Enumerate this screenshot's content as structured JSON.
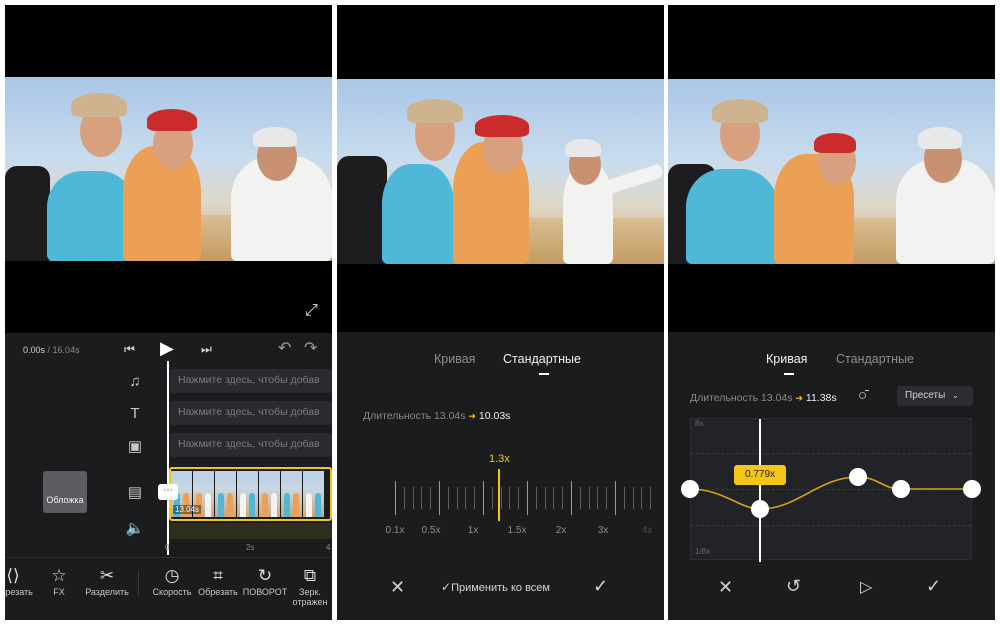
{
  "panel1": {
    "time_current": "0.00s",
    "time_sep": " / ",
    "time_total": "16.04s",
    "track_hint_audio": "Нажмите здесь, чтобы добав",
    "track_hint_text": "Нажмите здесь, чтобы добав",
    "track_hint_sticker": "Нажмите здесь, чтобы добав",
    "cover_label": "Обложка",
    "clip_duration": "13.04s",
    "ruler_marks": [
      "0",
      "2s",
      "4"
    ],
    "tools": [
      {
        "icon": "code-brackets-icon",
        "glyph": "⟨⟩",
        "label": "Обрезать"
      },
      {
        "icon": "star-icon",
        "glyph": "☆",
        "label": "FX"
      },
      {
        "icon": "scissors-icon",
        "glyph": "✂",
        "label": "Разделить"
      },
      {
        "icon": "speed-gauge-icon",
        "glyph": "◷",
        "label": "Скорость"
      },
      {
        "icon": "crop-icon",
        "glyph": "⌗",
        "label": "Обрезать"
      },
      {
        "icon": "rotate-icon",
        "glyph": "↻",
        "label": "ПОВОРОТ"
      },
      {
        "icon": "mirror-icon",
        "glyph": "⧉",
        "label": "Зерк. отражен"
      }
    ]
  },
  "panel2": {
    "tab_curve": "Кривая",
    "tab_standard": "Стандартные",
    "duration_label": "Длительность 13.04s",
    "arrow": "➔",
    "duration_new": "10.03s",
    "speed_value": "1.3x",
    "ruler_labels": [
      "0.1x",
      "0.5x",
      "1x",
      "1.5x",
      "2x",
      "3x",
      "4x"
    ],
    "apply_all": "Применить ко всем",
    "accent_color": "#f5c518"
  },
  "panel3": {
    "tab_curve": "Кривая",
    "tab_standard": "Стандартные",
    "duration_label": "Длительность 13.04s",
    "arrow": "➔",
    "duration_new": "11.38s",
    "presets_label": "Пресеты",
    "axis_top": "8x",
    "axis_bottom": "1/8x",
    "point_value": "0.779x"
  }
}
